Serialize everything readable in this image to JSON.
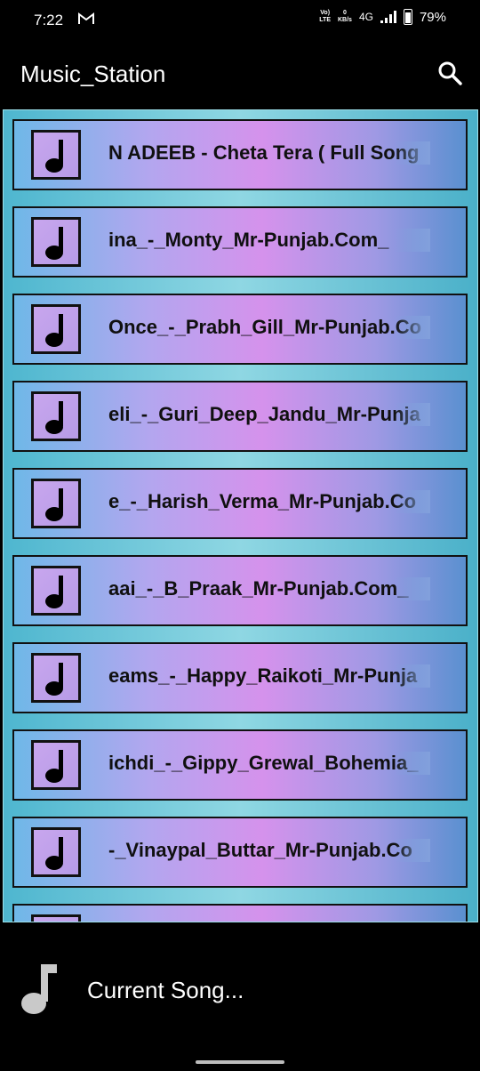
{
  "status_bar": {
    "time": "7:22",
    "volte": "Vo)",
    "lte": "LTE",
    "speed_value": "0",
    "speed_unit": "KB/s",
    "network": "4G",
    "battery": "79%"
  },
  "app_bar": {
    "title": "Music_Station",
    "search_icon": "search-icon"
  },
  "songs": [
    {
      "title": "N ADEEB - Cheta Tera ( Full Song"
    },
    {
      "title": "ina_-_Monty_Mr-Punjab.Com_"
    },
    {
      "title": "Once_-_Prabh_Gill_Mr-Punjab.Co"
    },
    {
      "title": "eli_-_Guri_Deep_Jandu_Mr-Punja"
    },
    {
      "title": "e_-_Harish_Verma_Mr-Punjab.Co"
    },
    {
      "title": "aai_-_B_Praak_Mr-Punjab.Com_"
    },
    {
      "title": "eams_-_Happy_Raikoti_Mr-Punja"
    },
    {
      "title": "ichdi_-_Gippy_Grewal_Bohemia_"
    },
    {
      "title": "-_Vinaypal_Buttar_Mr-Punjab.Co"
    },
    {
      "title": ""
    }
  ],
  "player": {
    "label": "Current Song...",
    "icon": "music-note-icon"
  },
  "colors": {
    "background": "#000000",
    "panel": "#4eb6cf",
    "item_pink": "#d592ec",
    "item_blue": "#6fb8e8"
  }
}
